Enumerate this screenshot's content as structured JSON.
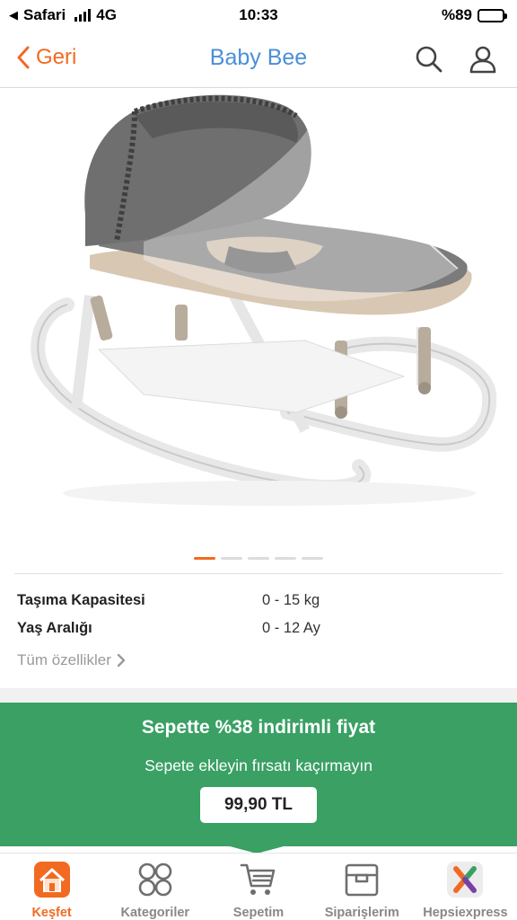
{
  "status": {
    "carrier": "Safari",
    "network": "4G",
    "time": "10:33",
    "battery": "%89",
    "battery_level": 0.89
  },
  "header": {
    "back_label": "Geri",
    "title": "Baby Bee"
  },
  "gallery": {
    "total": 5,
    "active_index": 0
  },
  "specs": [
    {
      "label": "Taşıma Kapasitesi",
      "value": "0 - 15 kg"
    },
    {
      "label": "Yaş Aralığı",
      "value": "0 - 12 Ay"
    }
  ],
  "all_specs_label": "Tüm özellikler",
  "promo": {
    "title": "Sepette %38 indirimli fiyat",
    "subtitle": "Sepete ekleyin fırsatı kaçırmayın",
    "price": "99,90 TL"
  },
  "tabs": [
    {
      "label": "Keşfet",
      "icon": "home-icon",
      "active": true
    },
    {
      "label": "Kategoriler",
      "icon": "categories-icon",
      "active": false
    },
    {
      "label": "Sepetim",
      "icon": "cart-icon",
      "active": false
    },
    {
      "label": "Siparişlerim",
      "icon": "orders-box-icon",
      "active": false
    },
    {
      "label": "Hepsiexpress",
      "icon": "hepsiexpress-icon",
      "active": false
    }
  ],
  "colors": {
    "accent": "#f26a21",
    "title_blue": "#4a8fd6",
    "promo_green": "#3aa064"
  }
}
